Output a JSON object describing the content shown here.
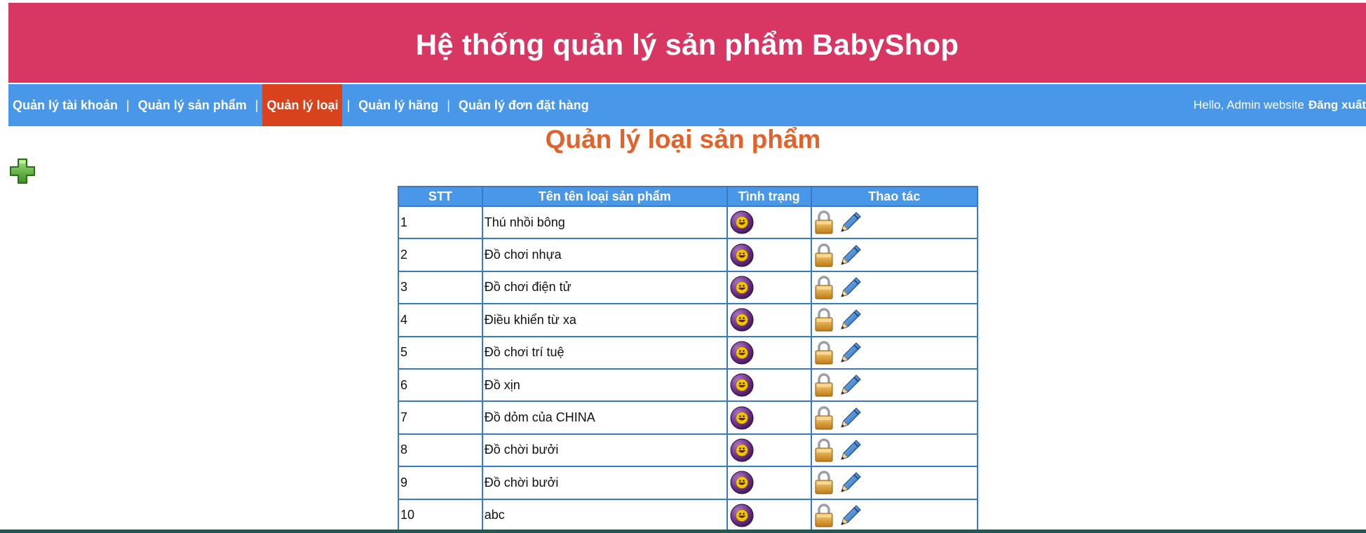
{
  "header": {
    "title": "Hệ thống quản lý sản phẩm BabyShop"
  },
  "nav": {
    "items": [
      {
        "label": "Quản lý tài khoản",
        "active": false
      },
      {
        "label": "Quản lý sản phẩm",
        "active": false
      },
      {
        "label": "Quản lý loại",
        "active": true
      },
      {
        "label": "Quản lý hãng",
        "active": false
      },
      {
        "label": "Quản lý đơn đặt hàng",
        "active": false
      }
    ],
    "separator": "|",
    "greeting": "Hello, Admin website",
    "logout_label": "Đăng xuất"
  },
  "page": {
    "title": "Quản lý loại sản phẩm",
    "add_icon": "plus-icon"
  },
  "table": {
    "headers": [
      "STT",
      "Tên tên loại sản phẩm",
      "Tình trạng",
      "Thao tác"
    ],
    "rows": [
      {
        "stt": "1",
        "name": "Thú nhồi bông"
      },
      {
        "stt": "2",
        "name": "Đồ chơi nhựa"
      },
      {
        "stt": "3",
        "name": "Đồ chơi điện tử"
      },
      {
        "stt": "4",
        "name": "Điều khiển từ xa"
      },
      {
        "stt": "5",
        "name": "Đồ chơi trí tuệ"
      },
      {
        "stt": "6",
        "name": "Đồ xịn"
      },
      {
        "stt": "7",
        "name": "Đồ dỏm của CHINA"
      },
      {
        "stt": "8",
        "name": "Đồ chời bưởi"
      },
      {
        "stt": "9",
        "name": "Đồ chời bưởi"
      },
      {
        "stt": "10",
        "name": "abc"
      }
    ],
    "status_icon": "smiley-icon",
    "action_icons": [
      "lock-icon",
      "pencil-icon"
    ]
  },
  "colors": {
    "header_bg": "#d83663",
    "nav_bg": "#4897e9",
    "nav_active_bg": "#d8431e",
    "title_color": "#e2622b",
    "table_border": "#3a78c2"
  }
}
